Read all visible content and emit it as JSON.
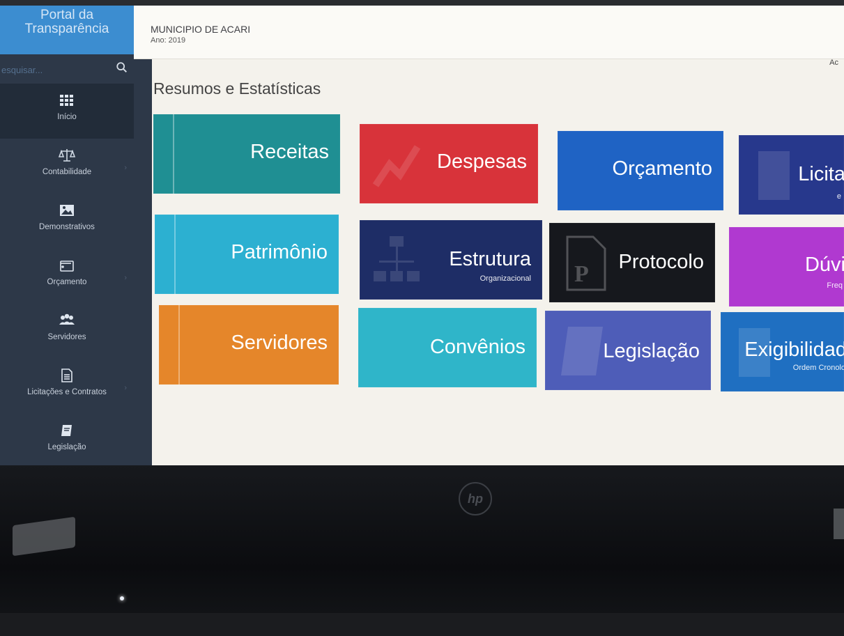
{
  "sidebar": {
    "brand_line1": "Portal da",
    "brand_line2": "Transparência",
    "search_placeholder": "esquisar...",
    "items": [
      {
        "label": "Início",
        "icon": "grid-icon"
      },
      {
        "label": "Contabilidade",
        "icon": "scale-icon"
      },
      {
        "label": "Demonstrativos",
        "icon": "image-icon"
      },
      {
        "label": "Orçamento",
        "icon": "wallet-icon"
      },
      {
        "label": "Servidores",
        "icon": "users-icon"
      },
      {
        "label": "Licitações e Contratos",
        "icon": "document-icon"
      },
      {
        "label": "Legislação",
        "icon": "book-icon"
      }
    ]
  },
  "header": {
    "municipality": "MUNICIPIO DE ACARI",
    "year": "Ano: 2019",
    "corner_text": "Ac"
  },
  "main": {
    "section_title": "Resumos e Estatísticas",
    "tiles": [
      {
        "title": "Receitas",
        "subtitle": "",
        "color": "#1f8f93"
      },
      {
        "title": "Despesas",
        "subtitle": "",
        "color": "#d8333a"
      },
      {
        "title": "Orçamento",
        "subtitle": "",
        "color": "#1f63c4"
      },
      {
        "title": "Licita",
        "subtitle": "e",
        "color": "#27388c"
      },
      {
        "title": "Patrimônio",
        "subtitle": "",
        "color": "#2cb0d1"
      },
      {
        "title": "Estrutura",
        "subtitle": "Organizacional",
        "color": "#1e2d66"
      },
      {
        "title": "Protocolo",
        "subtitle": "",
        "color": "#16181d"
      },
      {
        "title": "Dúvi",
        "subtitle": "Freq",
        "color": "#b039d0"
      },
      {
        "title": "Servidores",
        "subtitle": "",
        "color": "#e5862a"
      },
      {
        "title": "Convênios",
        "subtitle": "",
        "color": "#2fb5c9"
      },
      {
        "title": "Legislação",
        "subtitle": "",
        "color": "#4e5db8"
      },
      {
        "title": "Exigibilidad",
        "subtitle": "Ordem Cronolo",
        "color": "#1f6fc1"
      }
    ]
  }
}
